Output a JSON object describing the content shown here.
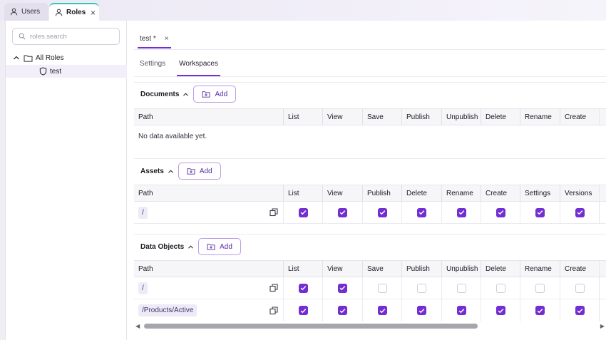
{
  "top_tabs": [
    {
      "label": "Users",
      "icon": "user-icon"
    },
    {
      "label": "Roles",
      "icon": "user-icon",
      "close": "×"
    }
  ],
  "sidebar": {
    "search_placeholder": "roles.search",
    "tree": {
      "root_label": "All Roles",
      "child_label": "test"
    }
  },
  "editor_tab": {
    "label": "test *",
    "close": "×"
  },
  "subtabs": [
    "Settings",
    "Workspaces"
  ],
  "add_label": "Add",
  "sections": {
    "documents": {
      "title": "Documents",
      "columns": [
        "Path",
        "List",
        "View",
        "Save",
        "Publish",
        "Unpublish",
        "Delete",
        "Rename",
        "Create"
      ],
      "empty_text": "No data available yet."
    },
    "assets": {
      "title": "Assets",
      "columns": [
        "Path",
        "List",
        "View",
        "Publish",
        "Delete",
        "Rename",
        "Create",
        "Settings",
        "Versions"
      ],
      "rows": [
        {
          "path": "/",
          "checks": [
            true,
            true,
            true,
            true,
            true,
            true,
            true,
            true
          ]
        }
      ]
    },
    "data_objects": {
      "title": "Data Objects",
      "columns": [
        "Path",
        "List",
        "View",
        "Save",
        "Publish",
        "Unpublish",
        "Delete",
        "Rename",
        "Create"
      ],
      "rows": [
        {
          "path": "/",
          "checks": [
            true,
            true,
            false,
            false,
            false,
            false,
            false,
            false
          ]
        },
        {
          "path": "/Products/Active",
          "checks": [
            true,
            true,
            true,
            true,
            true,
            true,
            true,
            true
          ]
        }
      ]
    }
  },
  "colors": {
    "accent": "#722ed1",
    "tab_indicator": "#2dc5bd",
    "header_bg": "#f6f5f8"
  }
}
